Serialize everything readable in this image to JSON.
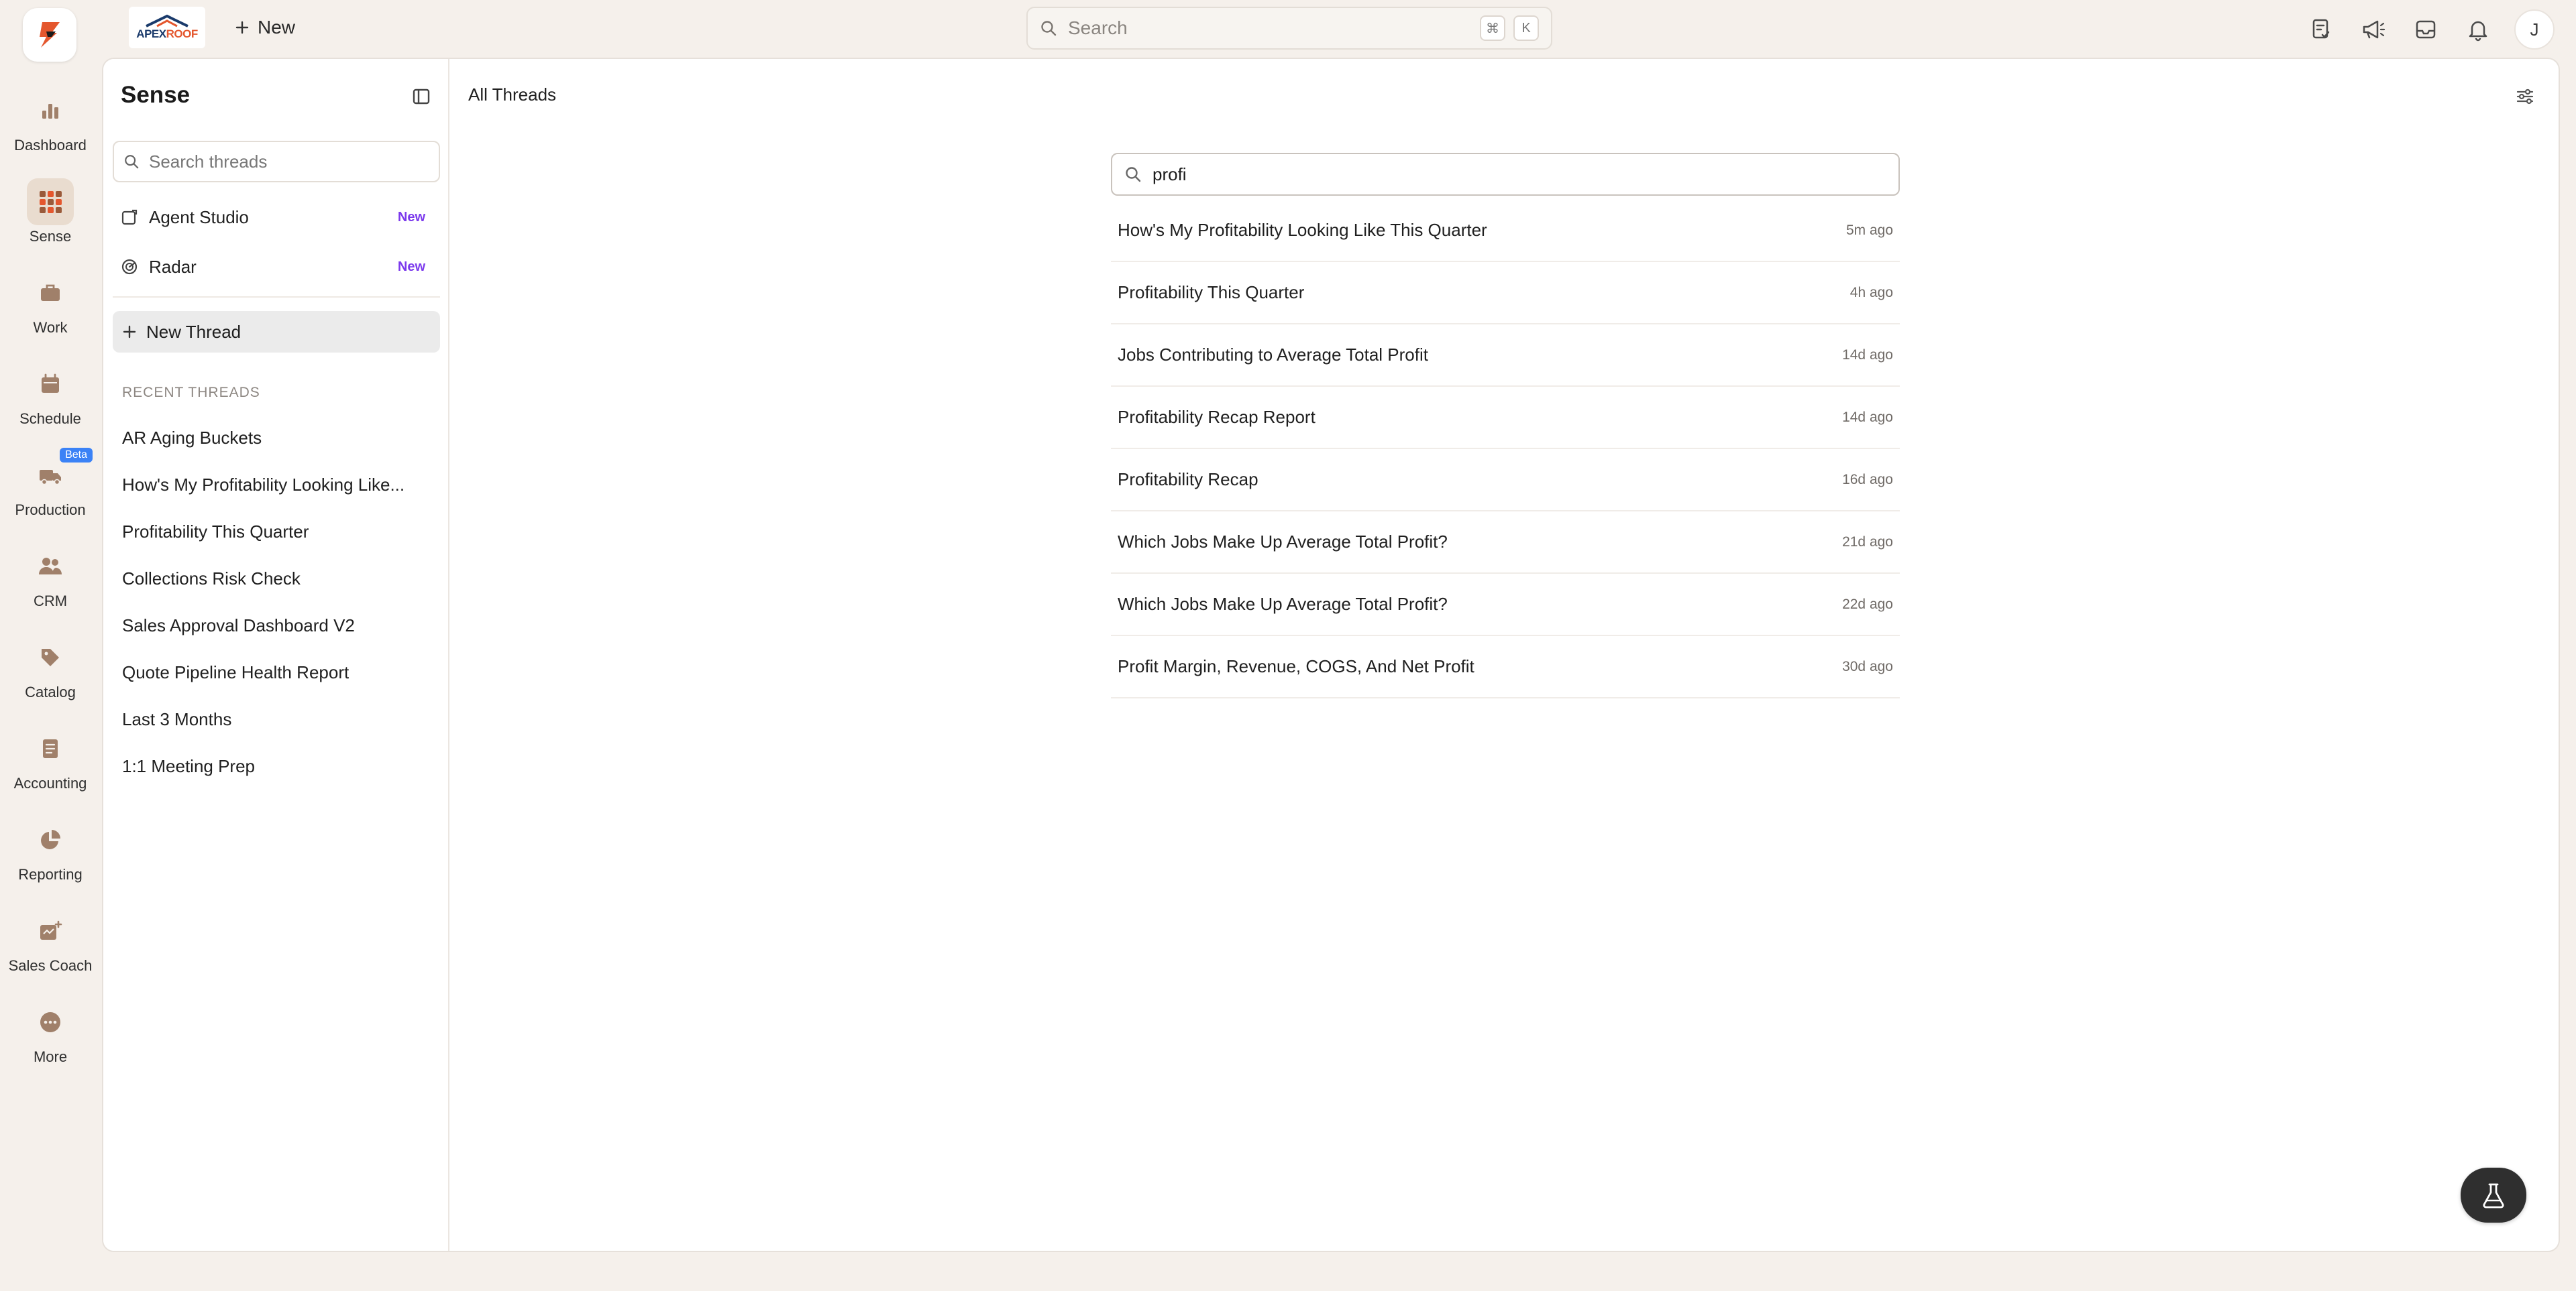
{
  "topbar": {
    "company_logo_text_1": "APEX",
    "company_logo_text_2": "ROOF",
    "new_label": "New",
    "search_placeholder": "Search",
    "shortcut_key_1": "⌘",
    "shortcut_key_2": "K",
    "avatar_initial": "J"
  },
  "leftnav": {
    "items": [
      {
        "label": "Dashboard",
        "icon": "bar-chart-icon"
      },
      {
        "label": "Sense",
        "icon": "grid-icon"
      },
      {
        "label": "Work",
        "icon": "briefcase-icon"
      },
      {
        "label": "Schedule",
        "icon": "calendar-icon"
      },
      {
        "label": "Production",
        "icon": "truck-icon",
        "badge": "Beta"
      },
      {
        "label": "CRM",
        "icon": "users-icon"
      },
      {
        "label": "Catalog",
        "icon": "tag-icon"
      },
      {
        "label": "Accounting",
        "icon": "document-icon"
      },
      {
        "label": "Reporting",
        "icon": "pie-chart-icon"
      },
      {
        "label": "Sales Coach",
        "icon": "coach-icon"
      },
      {
        "label": "More",
        "icon": "more-icon"
      }
    ]
  },
  "sidebar": {
    "title": "Sense",
    "search_placeholder": "Search threads",
    "links": [
      {
        "label": "Agent Studio",
        "badge": "New"
      },
      {
        "label": "Radar",
        "badge": "New"
      }
    ],
    "new_thread_label": "New Thread",
    "recent_header": "RECENT THREADS",
    "recent_threads": [
      "AR Aging Buckets",
      "How's My Profitability Looking Like...",
      "Profitability This Quarter",
      "Collections Risk Check",
      "Sales Approval Dashboard V2",
      "Quote Pipeline Health Report",
      "Last 3 Months",
      "1:1 Meeting Prep"
    ]
  },
  "content": {
    "title": "All Threads",
    "search_value": "profi",
    "results": [
      {
        "title": "How's My Profitability Looking Like This Quarter",
        "time": "5m ago"
      },
      {
        "title": "Profitability This Quarter",
        "time": "4h ago"
      },
      {
        "title": "Jobs Contributing to Average Total Profit",
        "time": "14d ago"
      },
      {
        "title": "Profitability Recap Report",
        "time": "14d ago"
      },
      {
        "title": "Profitability Recap",
        "time": "16d ago"
      },
      {
        "title": "Which Jobs Make Up Average Total Profit?",
        "time": "21d ago"
      },
      {
        "title": "Which Jobs Make Up Average Total Profit?",
        "time": "22d ago"
      },
      {
        "title": "Profit Margin, Revenue, COGS, And Net Profit",
        "time": "30d ago"
      }
    ]
  },
  "colors": {
    "background": "#f5f0eb",
    "brand_orange": "#e4572e",
    "new_badge": "#7c3aed",
    "beta_badge": "#3b82f6",
    "nav_icon": "#a0806a"
  }
}
